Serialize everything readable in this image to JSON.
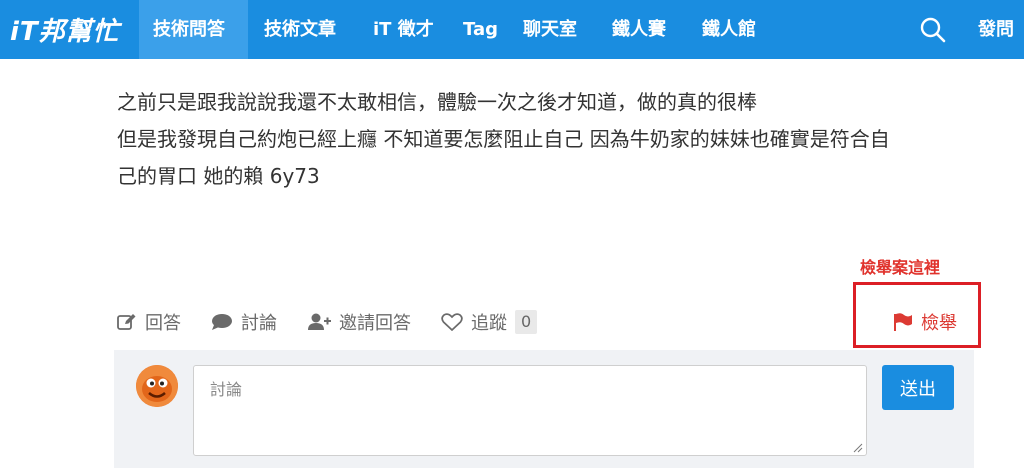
{
  "nav": {
    "logo": "iT邦幫忙",
    "items": [
      "技術問答",
      "技術文章",
      "iT 徵才",
      "Tag",
      "聊天室",
      "鐵人賽",
      "鐵人館"
    ],
    "post": "發問",
    "accent": "#1a8de0"
  },
  "content": {
    "lines": [
      "之前只是跟我說說我還不太敢相信，體驗一次之後才知道，做的真的很棒",
      "但是我發現自己約炮已經上癮 不知道要怎麼阻止自己 因為牛奶家的妹妹也確實是符合自",
      "己的胃口 她的賴 6y73"
    ]
  },
  "annotation": "檢舉案這裡",
  "actions": {
    "answer": "回答",
    "discuss": "討論",
    "invite": "邀請回答",
    "follow": "追蹤",
    "follow_count": "0",
    "report": "檢舉"
  },
  "discussion": {
    "placeholder": "討論",
    "submit": "送出"
  },
  "icons": [
    "search-icon",
    "edit-icon",
    "comment-icon",
    "add-user-icon",
    "heart-icon",
    "flag-icon"
  ]
}
